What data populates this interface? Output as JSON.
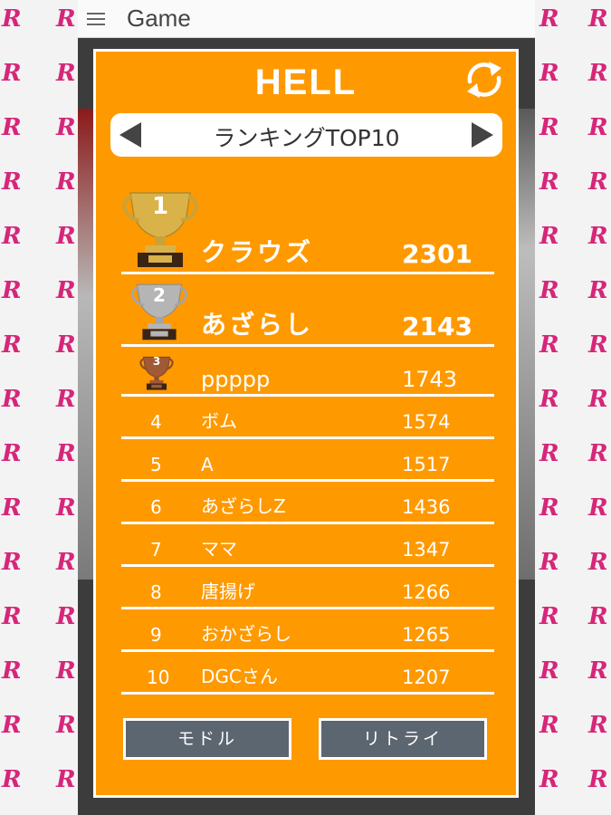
{
  "app": {
    "title": "Game"
  },
  "panel": {
    "difficulty": "HELL",
    "ranking_label": "ランキングTOP10"
  },
  "rankings": [
    {
      "rank": "1",
      "name": "クラウズ",
      "score": "2301",
      "trophy": "gold"
    },
    {
      "rank": "2",
      "name": "あざらし",
      "score": "2143",
      "trophy": "silver"
    },
    {
      "rank": "3",
      "name": "ppppp",
      "score": "1743",
      "trophy": "bronze"
    },
    {
      "rank": "4",
      "name": "ボム",
      "score": "1574"
    },
    {
      "rank": "5",
      "name": "A",
      "score": "1517"
    },
    {
      "rank": "6",
      "name": "あざらしZ",
      "score": "1436"
    },
    {
      "rank": "7",
      "name": "ママ",
      "score": "1347"
    },
    {
      "rank": "8",
      "name": "唐揚げ",
      "score": "1266"
    },
    {
      "rank": "9",
      "name": "おかざらし",
      "score": "1265"
    },
    {
      "rank": "10",
      "name": "DGCさん",
      "score": "1207"
    }
  ],
  "buttons": {
    "back": "モドル",
    "retry": "リトライ"
  },
  "pattern": {
    "mark": "R"
  },
  "colors": {
    "panel": "#ff9900",
    "button": "#5c6670",
    "pattern": "#d6267a",
    "gold": "#d9b24a",
    "silver": "#b5b5b5",
    "bronze": "#a05a35"
  }
}
